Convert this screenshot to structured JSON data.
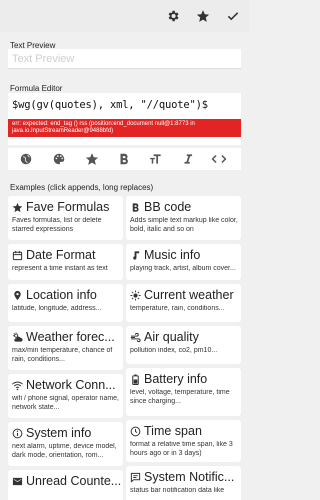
{
  "toolbar": {
    "icons": [
      "gear-icon",
      "star-icon",
      "check-icon"
    ]
  },
  "text_preview": {
    "label": "Text Preview",
    "placeholder": "Text Preview"
  },
  "formula_editor": {
    "label": "Formula Editor",
    "formula": "$wg(gv(quotes), xml, \"//quote\")$",
    "error": "err: expected: end_tag () rss (position:end_document null@1:8773 in java.io.InputStreamReader@9488bfd)"
  },
  "editor_tools": [
    "globe-icon",
    "palette-icon",
    "star-icon",
    "bold-icon",
    "text-size-icon",
    "italic-icon",
    "code-icon"
  ],
  "examples": {
    "label": "Examples (click appends, long replaces)",
    "cards": [
      {
        "title": "Fave Formulas",
        "desc": "Faves formulas, list or delete starred expressions",
        "icon": "star-icon"
      },
      {
        "title": "BB code",
        "desc": "Adds simple text markup like color, bold, italic and so on",
        "icon": "bold-icon"
      },
      {
        "title": "Date Format",
        "desc": "represent a time instant as text",
        "icon": "calendar-icon"
      },
      {
        "title": "Music info",
        "desc": "playing track, artist, album cover...",
        "icon": "music-note-icon"
      },
      {
        "title": "Location info",
        "desc": "latitude, longitude, address...",
        "icon": "location-pin-icon"
      },
      {
        "title": "Current weather",
        "desc": "temperature, rain, conditions...",
        "icon": "sun-icon"
      },
      {
        "title": "Weather forec...",
        "desc": "max/min temperature, chance of rain, conditions...",
        "icon": "cloud-sun-icon"
      },
      {
        "title": "Air quality",
        "desc": "pollution index, co2, pm10...",
        "icon": "wind-icon"
      },
      {
        "title": "Network Conn...",
        "desc": "wifi / phone signal, operator name, network state...",
        "icon": "wifi-icon"
      },
      {
        "title": "Battery info",
        "desc": "level, voltage, temperature, time since charging...",
        "icon": "battery-icon"
      },
      {
        "title": "System info",
        "desc": "next alarm, uptime, device model, dark mode, orientation, rom...",
        "icon": "info-icon"
      },
      {
        "title": "Time span",
        "desc": "format a relative time span, like 3 hours ago or in 3 days)",
        "icon": "clock-icon"
      },
      {
        "title": "Unread Counte...",
        "desc": "",
        "icon": "envelope-icon"
      },
      {
        "title": "System Notific...",
        "desc": "status bar notification data like",
        "icon": "message-icon"
      }
    ]
  }
}
